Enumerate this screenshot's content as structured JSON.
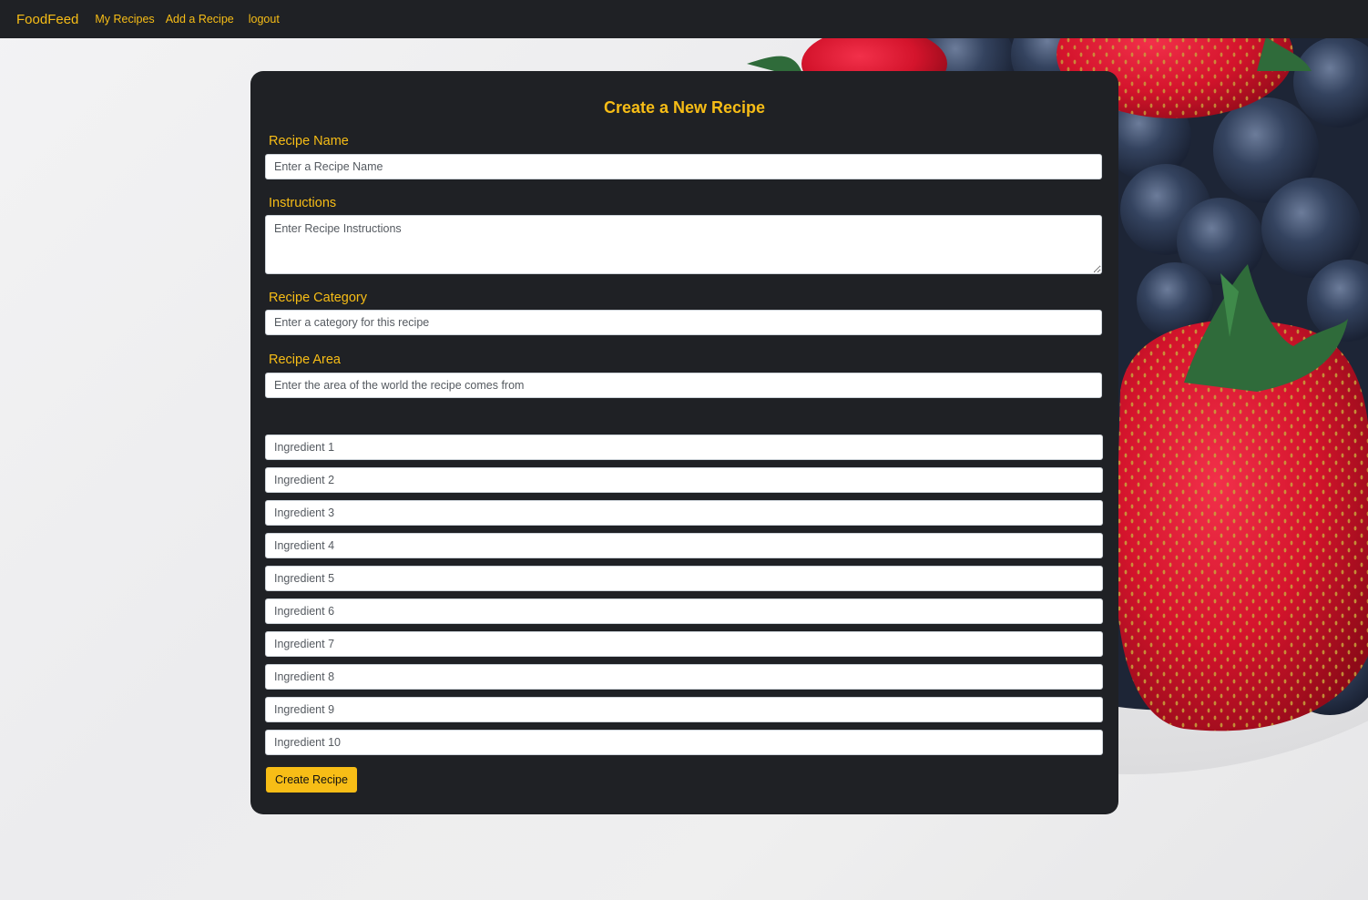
{
  "navbar": {
    "brand": "FoodFeed",
    "links": [
      {
        "label": "My Recipes"
      },
      {
        "label": "Add a Recipe"
      },
      {
        "label": "logout"
      }
    ]
  },
  "form": {
    "title": "Create a New Recipe",
    "recipe_name": {
      "label": "Recipe Name",
      "placeholder": "Enter a Recipe Name",
      "value": ""
    },
    "instructions": {
      "label": "Instructions",
      "placeholder": "Enter Recipe Instructions",
      "value": ""
    },
    "category": {
      "label": "Recipe Category",
      "placeholder": "Enter a category for this recipe",
      "value": ""
    },
    "area": {
      "label": "Recipe Area",
      "placeholder": "Enter the area of the world the recipe comes from",
      "value": ""
    },
    "ingredients": [
      {
        "placeholder": "Ingredient 1",
        "value": ""
      },
      {
        "placeholder": "Ingredient 2",
        "value": ""
      },
      {
        "placeholder": "Ingredient 3",
        "value": ""
      },
      {
        "placeholder": "Ingredient 4",
        "value": ""
      },
      {
        "placeholder": "Ingredient 5",
        "value": ""
      },
      {
        "placeholder": "Ingredient 6",
        "value": ""
      },
      {
        "placeholder": "Ingredient 7",
        "value": ""
      },
      {
        "placeholder": "Ingredient 8",
        "value": ""
      },
      {
        "placeholder": "Ingredient 9",
        "value": ""
      },
      {
        "placeholder": "Ingredient 10",
        "value": ""
      }
    ],
    "submit_label": "Create Recipe"
  },
  "colors": {
    "navbar_bg": "#1f2125",
    "accent": "#f7bd16",
    "card_bg": "#1f2125"
  }
}
